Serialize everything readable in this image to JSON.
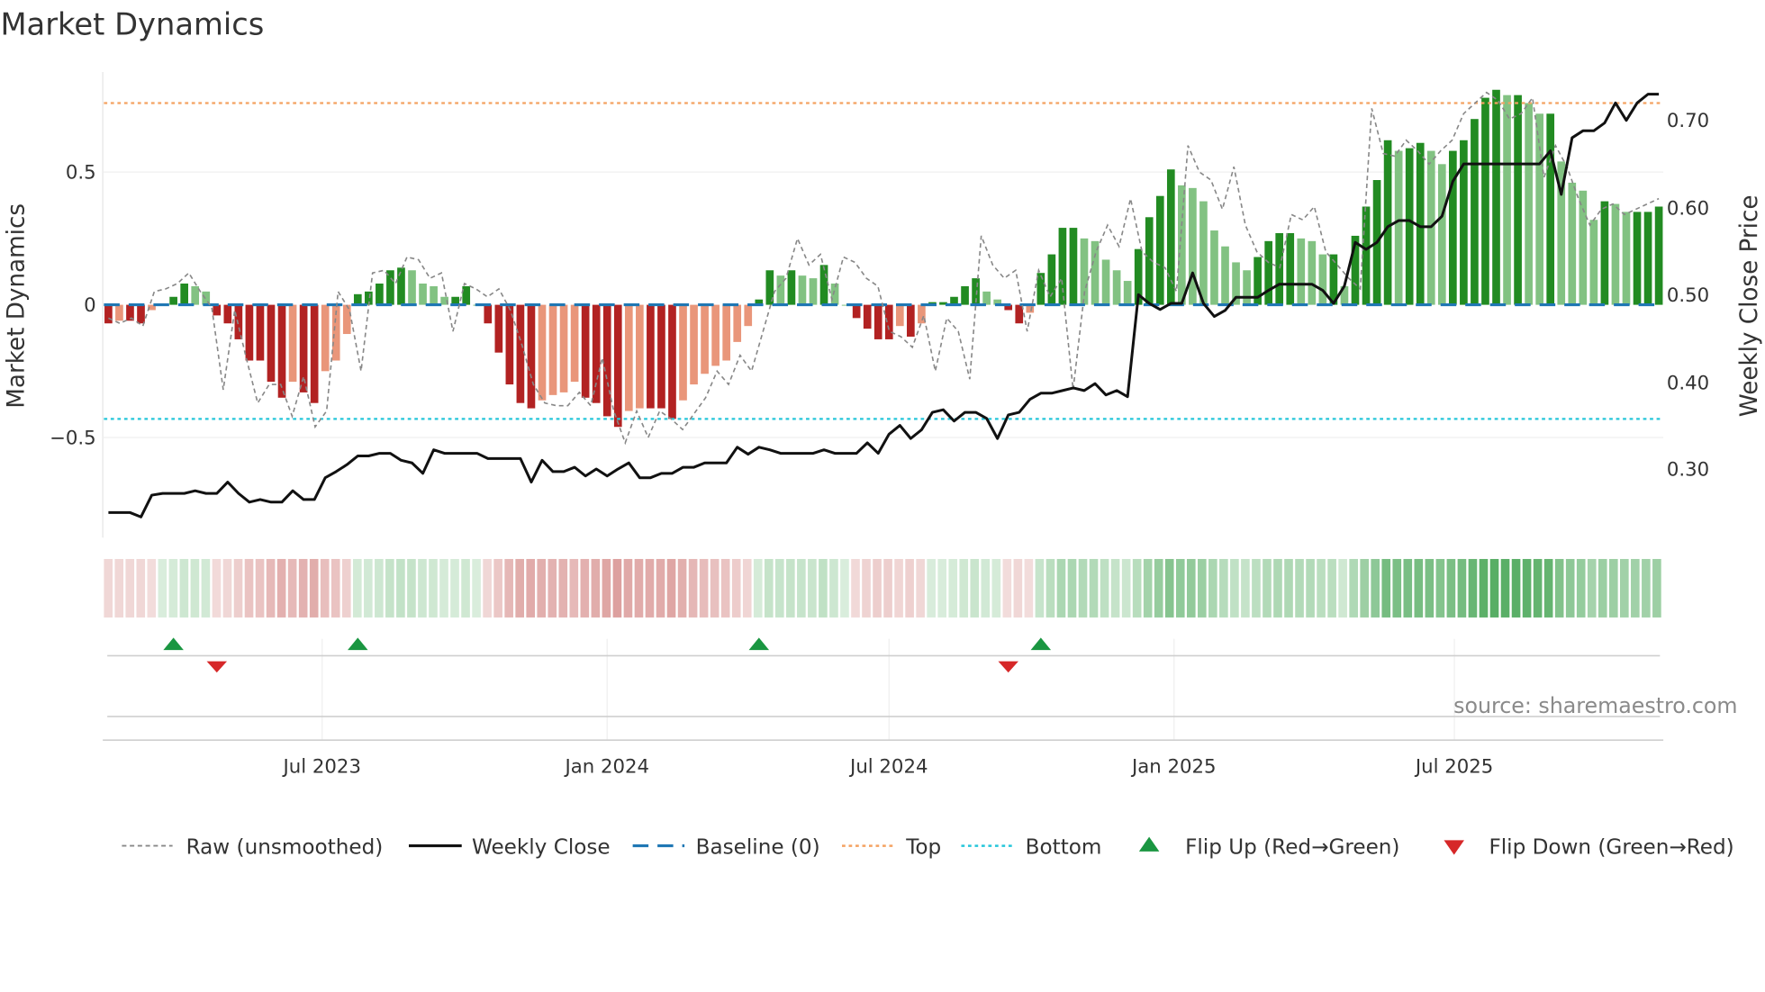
{
  "title": "Market Dynamics",
  "source": "source: sharemaestro.com",
  "colors": {
    "green_dark": "#228b22",
    "green_light": "#82c282",
    "red_dark": "#b22222",
    "red_light": "#e9967a",
    "close": "#111111",
    "raw": "#888888",
    "baseline": "#1f77b4",
    "top": "#f4a261",
    "bottom": "#26c6da",
    "flip_up": "#1a9641",
    "flip_down": "#d62728"
  },
  "chart_data": {
    "type": "bar",
    "start_week": "2023-02-13",
    "left_axis": {
      "label": "Market Dynamics",
      "ticks": [
        {
          "v": 0.5,
          "t": "0.5"
        },
        {
          "v": 0,
          "t": "0"
        },
        {
          "v": -0.5,
          "t": "−0.5"
        }
      ],
      "ylim": [
        -0.81,
        0.88
      ]
    },
    "right_axis": {
      "label": "Weekly Close Price",
      "ticks": [
        {
          "v": 0.7,
          "t": "0.70"
        },
        {
          "v": 0.6,
          "t": "0.60"
        },
        {
          "v": 0.5,
          "t": "0.50"
        },
        {
          "v": 0.4,
          "t": "0.40"
        },
        {
          "v": 0.3,
          "t": "0.30"
        }
      ]
    },
    "x_ticks": [
      {
        "date": "2023-07-01",
        "t": "Jul 2023"
      },
      {
        "date": "2024-01-01",
        "t": "Jan 2024"
      },
      {
        "date": "2024-07-01",
        "t": "Jul 2024"
      },
      {
        "date": "2025-01-01",
        "t": "Jan 2025"
      },
      {
        "date": "2025-07-01",
        "t": "Jul 2025"
      }
    ],
    "top_level": 0.76,
    "bottom_level": -0.43,
    "dynamics": [
      -0.07,
      -0.06,
      -0.06,
      -0.07,
      -0.02,
      0.0,
      0.03,
      0.08,
      0.07,
      0.05,
      -0.04,
      -0.07,
      -0.13,
      -0.21,
      -0.21,
      -0.29,
      -0.35,
      -0.29,
      -0.33,
      -0.37,
      -0.25,
      -0.21,
      -0.11,
      0.04,
      0.05,
      0.08,
      0.13,
      0.14,
      0.13,
      0.08,
      0.07,
      0.03,
      0.03,
      0.07,
      0.0,
      -0.07,
      -0.18,
      -0.3,
      -0.37,
      -0.39,
      -0.36,
      -0.34,
      -0.33,
      -0.29,
      -0.35,
      -0.37,
      -0.42,
      -0.46,
      -0.4,
      -0.39,
      -0.39,
      -0.39,
      -0.43,
      -0.36,
      -0.3,
      -0.26,
      -0.23,
      -0.21,
      -0.14,
      -0.08,
      0.02,
      0.13,
      0.11,
      0.13,
      0.11,
      0.1,
      0.15,
      0.08,
      0.0,
      -0.05,
      -0.09,
      -0.13,
      -0.13,
      -0.08,
      -0.12,
      -0.07,
      0.01,
      0.01,
      0.03,
      0.07,
      0.1,
      0.05,
      0.02,
      -0.02,
      -0.07,
      -0.03,
      0.12,
      0.19,
      0.29,
      0.29,
      0.25,
      0.24,
      0.17,
      0.13,
      0.09,
      0.21,
      0.33,
      0.41,
      0.51,
      0.45,
      0.44,
      0.39,
      0.28,
      0.22,
      0.16,
      0.13,
      0.18,
      0.24,
      0.27,
      0.27,
      0.25,
      0.24,
      0.19,
      0.19,
      0.07,
      0.26,
      0.37,
      0.47,
      0.62,
      0.58,
      0.59,
      0.61,
      0.58,
      0.53,
      0.58,
      0.62,
      0.7,
      0.78,
      0.81,
      0.79,
      0.79,
      0.76,
      0.72,
      0.72,
      0.54,
      0.46,
      0.43,
      0.32,
      0.39,
      0.38,
      0.35,
      0.35,
      0.35,
      0.37
    ],
    "raw": [
      -0.05,
      -0.07,
      -0.05,
      -0.08,
      0.05,
      0.06,
      0.08,
      0.12,
      0.05,
      -0.01,
      -0.32,
      -0.02,
      -0.2,
      -0.37,
      -0.3,
      -0.3,
      -0.42,
      -0.27,
      -0.46,
      -0.4,
      0.05,
      -0.02,
      -0.25,
      0.12,
      0.13,
      0.08,
      0.18,
      0.17,
      0.1,
      0.12,
      -0.1,
      0.08,
      0.06,
      0.03,
      0.06,
      -0.02,
      -0.15,
      -0.3,
      -0.37,
      -0.38,
      -0.38,
      -0.33,
      -0.38,
      -0.2,
      -0.4,
      -0.52,
      -0.4,
      -0.5,
      -0.4,
      -0.43,
      -0.47,
      -0.41,
      -0.35,
      -0.25,
      -0.3,
      -0.19,
      -0.25,
      -0.1,
      0.05,
      0.1,
      0.25,
      0.15,
      0.19,
      0.02,
      0.18,
      0.16,
      0.1,
      0.07,
      -0.1,
      -0.12,
      -0.16,
      -0.04,
      -0.25,
      -0.05,
      -0.1,
      -0.28,
      0.26,
      0.15,
      0.1,
      0.13,
      -0.1,
      0.13,
      0.03,
      0.1,
      -0.32,
      0.05,
      0.2,
      0.3,
      0.22,
      0.4,
      0.2,
      0.16,
      0.14,
      0.05,
      0.6,
      0.5,
      0.47,
      0.36,
      0.52,
      0.3,
      0.2,
      0.16,
      0.14,
      0.34,
      0.32,
      0.37,
      0.2,
      0.15,
      0.1,
      0.06,
      0.74,
      0.57,
      0.56,
      0.62,
      0.58,
      0.53,
      0.58,
      0.62,
      0.72,
      0.76,
      0.8,
      0.77,
      0.7,
      0.72,
      0.78,
      0.48,
      0.6,
      0.52,
      0.4,
      0.3,
      0.36,
      0.38,
      0.34,
      0.36,
      0.38,
      0.4
    ],
    "close": [
      0.25,
      0.25,
      0.25,
      0.245,
      0.27,
      0.272,
      0.272,
      0.272,
      0.275,
      0.272,
      0.272,
      0.285,
      0.272,
      0.262,
      0.265,
      0.262,
      0.262,
      0.275,
      0.265,
      0.265,
      0.29,
      0.297,
      0.305,
      0.315,
      0.315,
      0.318,
      0.318,
      0.31,
      0.307,
      0.295,
      0.322,
      0.318,
      0.318,
      0.318,
      0.318,
      0.312,
      0.312,
      0.312,
      0.312,
      0.285,
      0.31,
      0.297,
      0.297,
      0.302,
      0.292,
      0.3,
      0.292,
      0.3,
      0.307,
      0.29,
      0.29,
      0.295,
      0.295,
      0.302,
      0.302,
      0.307,
      0.307,
      0.307,
      0.325,
      0.317,
      0.325,
      0.322,
      0.318,
      0.318,
      0.318,
      0.318,
      0.322,
      0.318,
      0.318,
      0.318,
      0.33,
      0.318,
      0.34,
      0.35,
      0.335,
      0.345,
      0.365,
      0.368,
      0.355,
      0.365,
      0.365,
      0.358,
      0.335,
      0.362,
      0.365,
      0.38,
      0.387,
      0.387,
      0.39,
      0.393,
      0.39,
      0.398,
      0.385,
      0.39,
      0.383,
      0.5,
      0.49,
      0.483,
      0.49,
      0.49,
      0.525,
      0.49,
      0.475,
      0.482,
      0.497,
      0.497,
      0.497,
      0.505,
      0.512,
      0.512,
      0.512,
      0.512,
      0.505,
      0.49,
      0.51,
      0.56,
      0.552,
      0.56,
      0.578,
      0.585,
      0.585,
      0.578,
      0.578,
      0.59,
      0.63,
      0.65,
      0.65,
      0.65,
      0.65,
      0.65,
      0.65,
      0.65,
      0.65,
      0.665,
      0.615,
      0.68,
      0.688,
      0.688,
      0.697,
      0.72,
      0.7,
      0.72,
      0.73,
      0.73
    ],
    "legend": {
      "raw": "Raw (unsmoothed)",
      "close": "Weekly Close",
      "baseline": "Baseline (0)",
      "top": "Top",
      "bottom": "Bottom",
      "flip_up": "Flip Up (Red→Green)",
      "flip_down": "Flip Down (Green→Red)"
    }
  }
}
